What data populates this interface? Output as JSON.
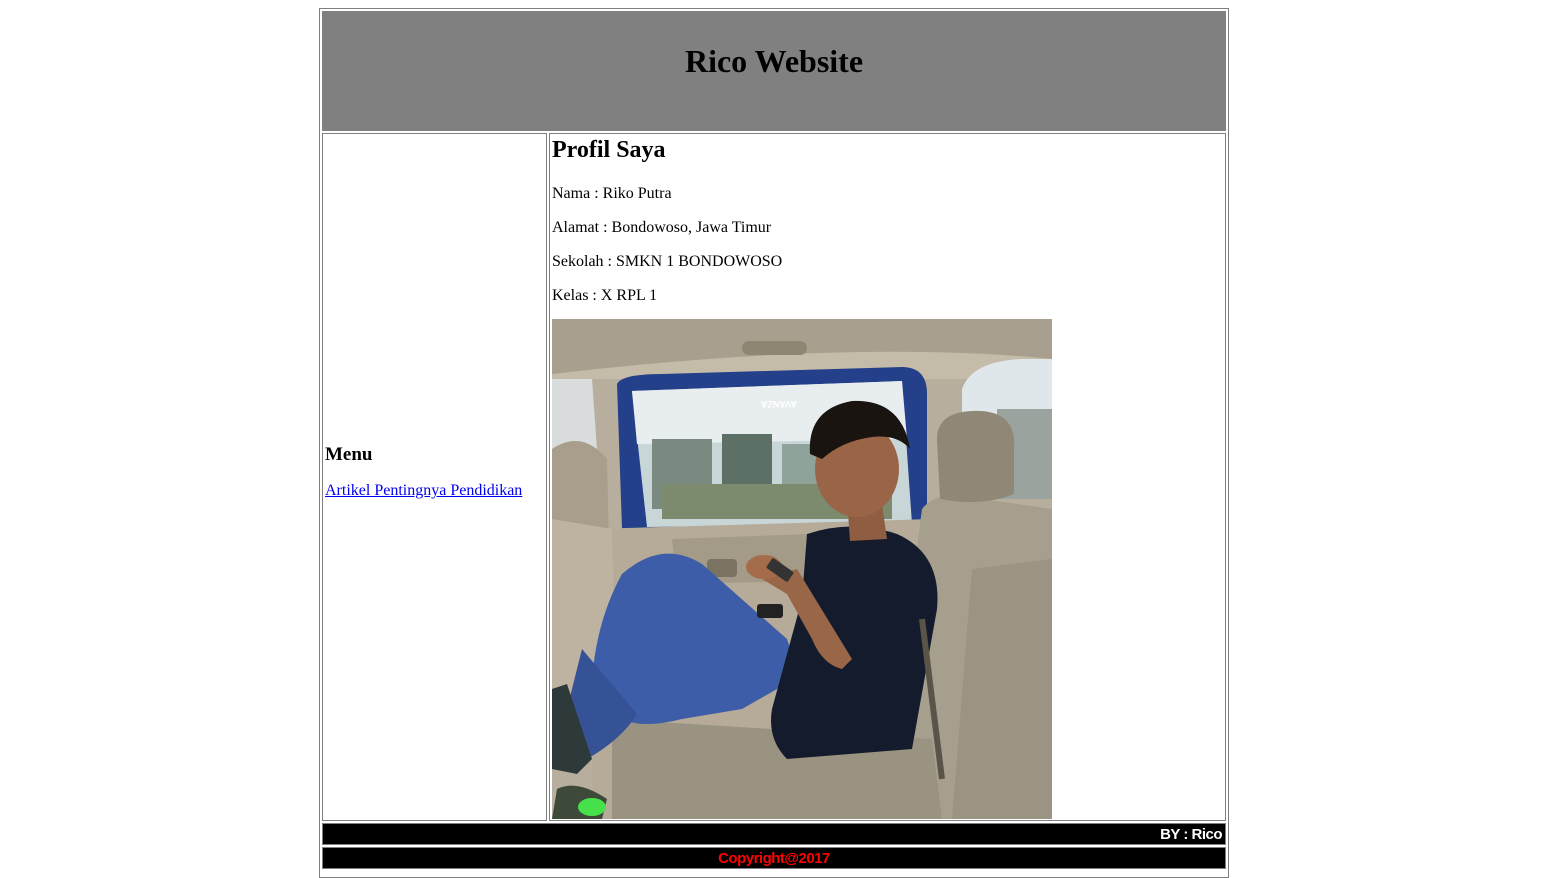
{
  "header": {
    "title": "Rico Website"
  },
  "menu": {
    "heading": "Menu",
    "links": [
      {
        "label": "Artikel Pentingnya Pendidikan"
      }
    ]
  },
  "profile": {
    "heading": "Profil Saya",
    "fields": [
      "Nama : Riko Putra",
      "Alamat : Bondowoso, Jawa Timur",
      "Sekolah : SMKN 1 BONDOWOSO",
      "Kelas : X RPL 1"
    ],
    "photo_alt": "profile-photo",
    "car_sticker": "AVANZA"
  },
  "footer": {
    "by": "BY : Rico",
    "copyright": "Copyright@2017"
  },
  "colors": {
    "header_bg": "#808080",
    "footer_bg": "#000000",
    "by_text": "#ffffff",
    "copyright_text": "#ff0000",
    "link": "#0000ee"
  }
}
